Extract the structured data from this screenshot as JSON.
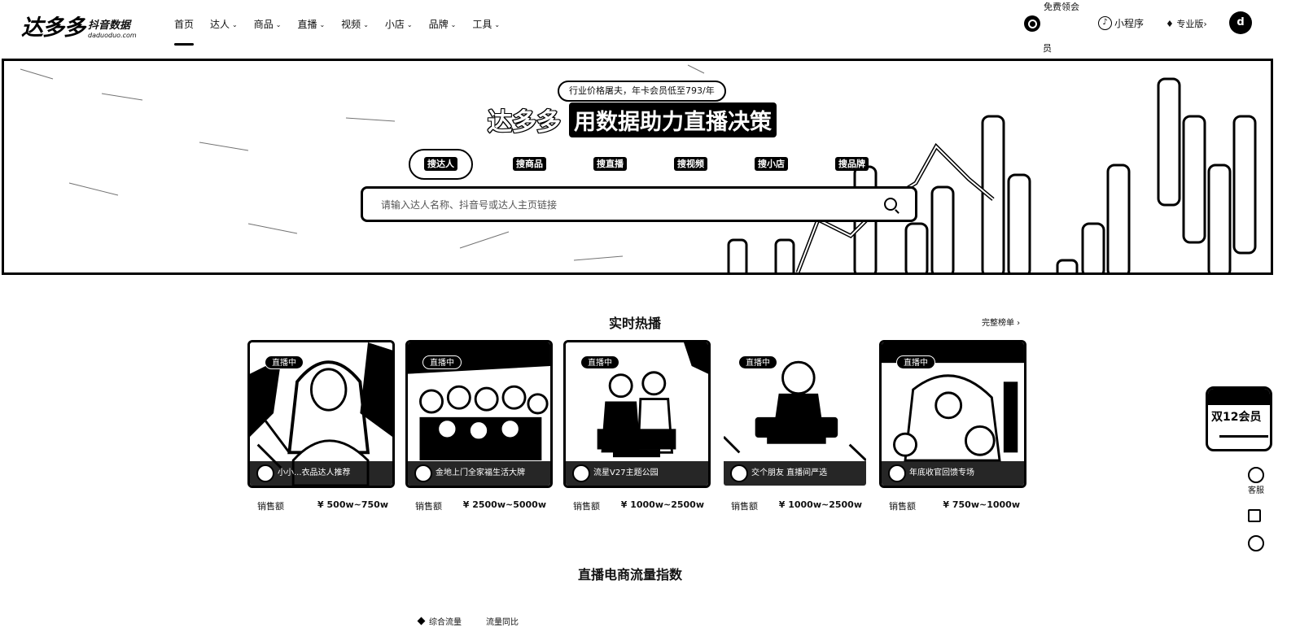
{
  "logo": {
    "main": "达多多",
    "sub_cn": "抖音数据",
    "sub_en": "daduoduo.com"
  },
  "nav": [
    {
      "label": "首页",
      "caret": ""
    },
    {
      "label": "达人",
      "caret": "⌄"
    },
    {
      "label": "商品",
      "caret": "⌄"
    },
    {
      "label": "直播",
      "caret": "⌄"
    },
    {
      "label": "视频",
      "caret": "⌄"
    },
    {
      "label": "小店",
      "caret": "⌄"
    },
    {
      "label": "品牌",
      "caret": "⌄"
    },
    {
      "label": "工具",
      "caret": "⌄"
    }
  ],
  "header_right": {
    "member_label": "免费领会",
    "member_sub": "员",
    "mini_program": "小程序",
    "pro": "专业版",
    "pro_arrow": "›",
    "avatar_text": "d"
  },
  "banner": {
    "promo": "行业价格屠夫，年卡会员低至793/年",
    "brand": "达多多",
    "slogan": "用数据助力直播决策",
    "tabs": [
      "搜达人",
      "搜商品",
      "搜直播",
      "搜视频",
      "搜小店",
      "搜品牌"
    ],
    "search_placeholder": "请输入达人名称、抖音号或达人主页链接"
  },
  "hot_live": {
    "title": "实时热播",
    "more": "完整榜单 ›",
    "badge": "直播中",
    "sales_label": "销售额",
    "cards": [
      {
        "caption": "小小...衣品达人推荐",
        "sales": "¥ 500w~750w"
      },
      {
        "caption": "金地上门全家福生活大牌",
        "sales": "¥ 2500w~5000w"
      },
      {
        "caption": "流星V27主题公园",
        "sales": "¥ 1000w~2500w"
      },
      {
        "caption": "交个朋友 直播间严选",
        "sales": "¥ 1000w~2500w"
      },
      {
        "caption": "年底收官回馈专场",
        "sales": "¥ 750w~1000w"
      }
    ]
  },
  "traffic": {
    "title": "直播电商流量指数",
    "legend": [
      "综合流量",
      "流量同比"
    ]
  },
  "float": {
    "promo": "双12会员",
    "service": "客服"
  }
}
